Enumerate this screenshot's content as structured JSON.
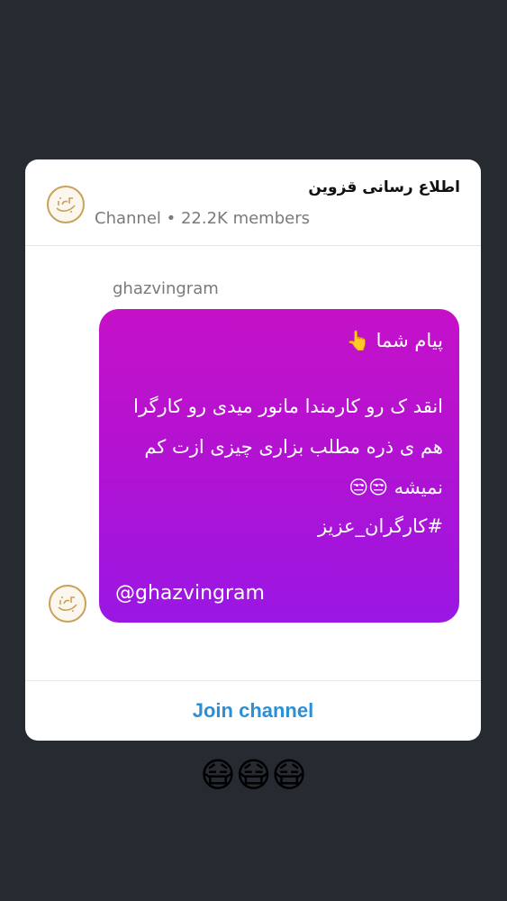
{
  "channel": {
    "name": "اطلاع رسانی قزوین",
    "meta": "Channel • 22.2K members",
    "avatar_icon": "ghazvin-logo-icon"
  },
  "message": {
    "sender": "ghazvingram",
    "lines": [
      "پیام شما 👆",
      "انقد ک رو کارمندا مانور میدی رو کارگرا",
      "هم ی ذره مطلب بزاری چیزی ازت کم",
      "نمیشه 😒😒",
      "#کارگران_عزیز"
    ],
    "handle": "@ghazvingram",
    "gradient_top": "#c511c8",
    "gradient_bottom": "#9a17e4"
  },
  "join_label": "Join channel",
  "footer_emoji": "😷😷😷",
  "colors": {
    "background": "#262a31",
    "link": "#2b8fd6",
    "logo": "#c8a25a"
  }
}
